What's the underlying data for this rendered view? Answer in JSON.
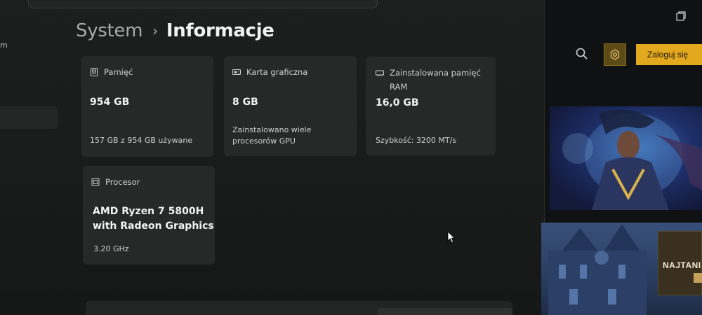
{
  "breadcrumb": {
    "parent": "System",
    "separator": "›",
    "current": "Informacje"
  },
  "sidebar": {
    "partial_label": "m"
  },
  "cards": {
    "storage": {
      "icon": "storage-icon",
      "title": "Pamięć",
      "value": "954 GB",
      "sub": "157 GB z 954 GB używane"
    },
    "gpu": {
      "icon": "gpu-icon",
      "title": "Karta graficzna",
      "value": "8 GB",
      "sub_line1": "Zainstalowano wiele",
      "sub_line2": "procesorów GPU"
    },
    "ram": {
      "icon": "ram-icon",
      "title_line1": "Zainstalowana pamięć",
      "title_line2": "RAM",
      "value": "16,0 GB",
      "sub": "Szybkość: 3200 MT/s"
    },
    "cpu": {
      "icon": "cpu-icon",
      "title": "Procesor",
      "value_line1": "AMD Ryzen 7 5800H",
      "value_line2": "with Radeon Graphics",
      "sub": "3.20 GHz"
    }
  },
  "right_app": {
    "login_label": "Zaloguj się",
    "promo_text": "NAJTANI",
    "colors": {
      "accent": "#e2a91f",
      "gear_bg": "#5c4a17"
    }
  }
}
